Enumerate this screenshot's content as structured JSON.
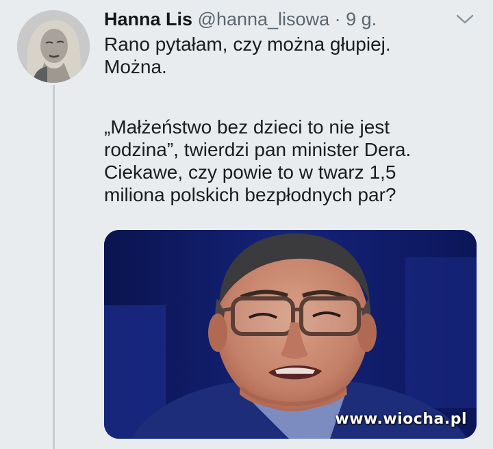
{
  "tweet": {
    "author_name": "Hanna Lis",
    "handle": "@hanna_lisowa",
    "separator": "·",
    "time": "9 g.",
    "text_lines": [
      "Rano pytałam, czy można głupiej.",
      "Można.",
      "„Małżeństwo bez dzieci to nie jest",
      "rodzina”, twierdzi pan minister Dera.",
      "Ciekawe, czy powie to w twarz 1,5",
      "miliona polskich bezpłodnych par?"
    ]
  },
  "icons": {
    "menu": "chevron-down-icon"
  },
  "watermark": "www.wiocha.pl",
  "colors": {
    "background": "#e9ecee",
    "secondary_text": "#5b6670",
    "thread_line": "#c8ccd0"
  }
}
